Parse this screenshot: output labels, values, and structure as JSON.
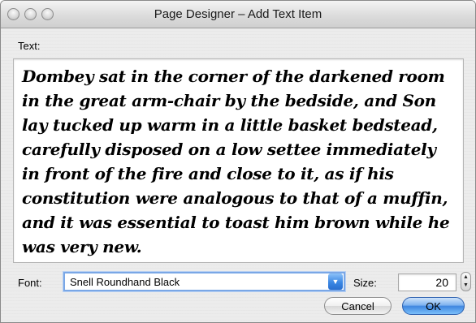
{
  "window": {
    "title": "Page Designer – Add Text Item"
  },
  "form": {
    "text_label": "Text:",
    "text_value": "Dombey sat in the corner of the darkened room in the great arm-chair by the bedside, and Son lay tucked up warm in a little basket bedstead, carefully disposed on a low settee immediately in front of the fire and close to it, as if his constitution were analogous to that of a muffin, and it was essential to toast him brown while he was very new.",
    "font_label": "Font:",
    "font_value": "Snell Roundhand Black",
    "size_label": "Size:",
    "size_value": "20"
  },
  "buttons": {
    "cancel": "Cancel",
    "ok": "OK"
  },
  "icons": {
    "combo_arrow": "chevron-down-icon",
    "stepper_up": "triangle-up-icon",
    "stepper_down": "triangle-down-icon"
  },
  "colors": {
    "default_button": "#3f86e0",
    "focus_ring": "#7aa7e6"
  }
}
